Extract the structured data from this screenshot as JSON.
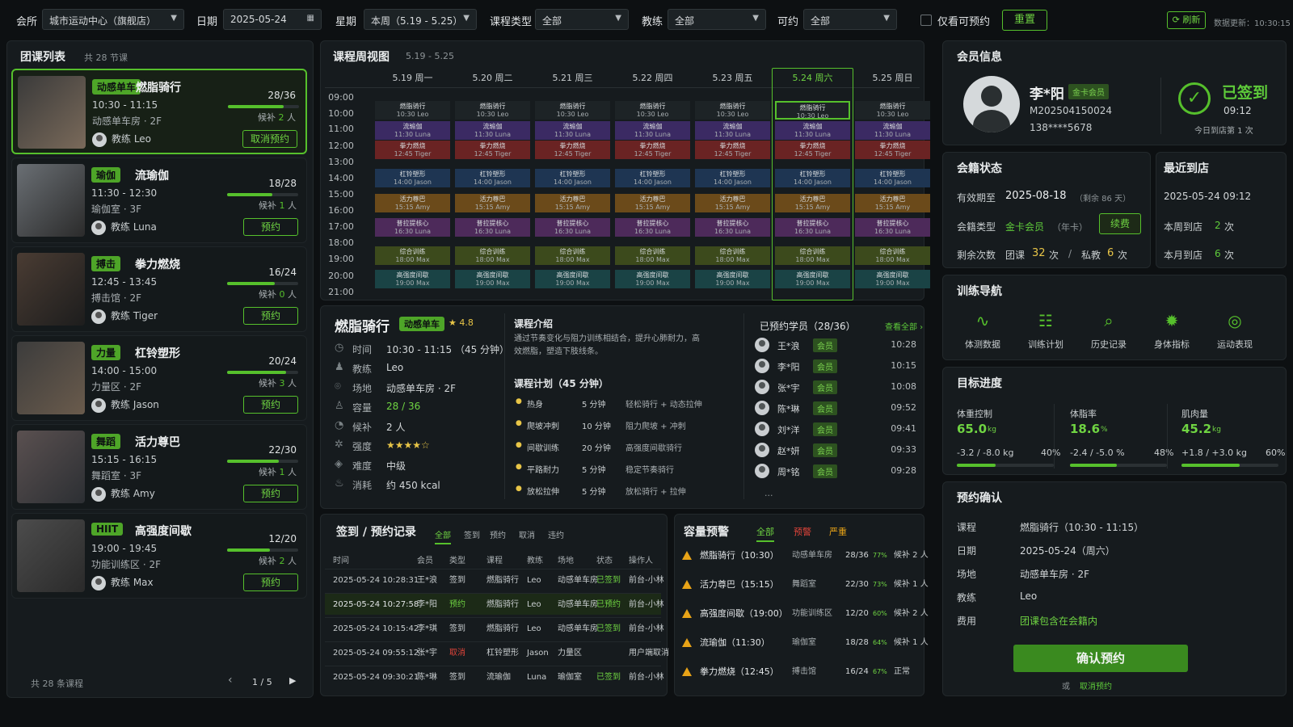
{
  "filters": {
    "club_label": "会所",
    "club_value": "城市运动中心（旗舰店）",
    "date_label": "日期",
    "date_value": "2025-05-24",
    "week_label": "星期",
    "week_value": "本周（5.19 - 5.25）",
    "type_label": "课程类型",
    "type_value": "全部",
    "coach_label": "教练",
    "coach_value": "全部",
    "avail_label": "可约",
    "avail_value": "全部",
    "only_bookable": "仅看可预约",
    "reset": "重置",
    "refresh": "刷新",
    "updated": "数据更新：10:30:15"
  },
  "class_list": {
    "title": "团课列表",
    "count": "共 28 节课",
    "items": [
      {
        "tag": "动感单车",
        "name": "燃脂骑行",
        "time": "10:30 - 11:15",
        "room": "动感单车房 · 2F",
        "coach": "教练  Leo",
        "count": "28/36",
        "fill": 0.78,
        "wait_label": "候补",
        "wait_num": "2",
        "wait_unit": "人",
        "action": "取消预约"
      },
      {
        "tag": "瑜伽",
        "name": "流瑜伽",
        "time": "11:30 - 12:30",
        "room": "瑜伽室 · 3F",
        "coach": "教练  Luna",
        "count": "18/28",
        "fill": 0.64,
        "wait_label": "候补",
        "wait_num": "1",
        "wait_unit": "人",
        "action": "预约"
      },
      {
        "tag": "搏击",
        "name": "拳力燃烧",
        "time": "12:45 - 13:45",
        "room": "搏击馆 · 2F",
        "coach": "教练  Tiger",
        "count": "16/24",
        "fill": 0.67,
        "wait_label": "候补",
        "wait_num": "0",
        "wait_unit": "人",
        "action": "预约"
      },
      {
        "tag": "力量",
        "name": "杠铃塑形",
        "time": "14:00 - 15:00",
        "room": "力量区 · 2F",
        "coach": "教练  Jason",
        "count": "20/24",
        "fill": 0.83,
        "wait_label": "候补",
        "wait_num": "3",
        "wait_unit": "人",
        "action": "预约"
      },
      {
        "tag": "舞蹈",
        "name": "活力尊巴",
        "time": "15:15 - 16:15",
        "room": "舞蹈室 · 3F",
        "coach": "教练  Amy",
        "count": "22/30",
        "fill": 0.73,
        "wait_label": "候补",
        "wait_num": "1",
        "wait_unit": "人",
        "action": "预约"
      },
      {
        "tag": "HIIT",
        "name": "高强度间歇",
        "time": "19:00 - 19:45",
        "room": "功能训练区 · 2F",
        "coach": "教练  Max",
        "count": "12/20",
        "fill": 0.6,
        "wait_label": "候补",
        "wait_num": "2",
        "wait_unit": "人",
        "action": "预约"
      }
    ],
    "footer": "共 28 条课程",
    "page": "1 / 5"
  },
  "calendar": {
    "title": "课程周视图",
    "range": "5.19 - 5.25",
    "days": [
      "5.19 周一",
      "5.20 周二",
      "5.21 周三",
      "5.22 周四",
      "5.23 周五",
      "5.24 周六",
      "5.25 周日"
    ],
    "times": [
      "09:00",
      "10:00",
      "11:00",
      "12:00",
      "13:00",
      "14:00",
      "15:00",
      "16:00",
      "17:00",
      "18:00",
      "19:00",
      "20:00",
      "21:00"
    ],
    "classes": [
      {
        "name": "燃脂骑行",
        "sub": "10:30  Leo",
        "color": "#1d2326"
      },
      {
        "name": "流瑜伽",
        "sub": "11:30  Luna",
        "color": "#3b2a63"
      },
      {
        "name": "拳力燃烧",
        "sub": "12:45  Tiger",
        "color": "#6a2323"
      },
      {
        "name": "杠铃塑形",
        "sub": "14:00  Jason",
        "color": "#1e3552"
      },
      {
        "name": "活力尊巴",
        "sub": "15:15  Amy",
        "color": "#6b4a1a"
      },
      {
        "name": "普拉提核心",
        "sub": "16:30  Luna",
        "color": "#4d2a5a"
      },
      {
        "name": "综合训练",
        "sub": "18:00  Max",
        "color": "#3c4a1c"
      },
      {
        "name": "高强度间歇",
        "sub": "19:00  Max",
        "color": "#1a4345"
      }
    ]
  },
  "detail": {
    "name": "燃脂骑行",
    "tag": "动感单车",
    "rating": "★ 4.8",
    "rows": [
      {
        "label": "时间",
        "value": "10:30 - 11:15  （45 分钟）",
        "icon": "clock-icon",
        "glyph": "◷"
      },
      {
        "label": "教练",
        "value": "Leo",
        "icon": "coach-icon",
        "glyph": "♟"
      },
      {
        "label": "场地",
        "value": "动感单车房 · 2F",
        "icon": "location-icon",
        "glyph": "⌾"
      },
      {
        "label": "容量",
        "value": "28 / 36",
        "icon": "people-icon",
        "glyph": "♙"
      },
      {
        "label": "候补",
        "value": "2 人",
        "icon": "waitlist-icon",
        "glyph": "◔"
      },
      {
        "label": "强度",
        "value": "★★★★☆",
        "icon": "intensity-icon",
        "glyph": "✲"
      },
      {
        "label": "难度",
        "value": "中级",
        "icon": "difficulty-icon",
        "glyph": "◈"
      },
      {
        "label": "消耗",
        "value": "约 450 kcal",
        "icon": "calorie-icon",
        "glyph": "♨"
      }
    ],
    "intro_title": "课程介绍",
    "intro": "通过节奏变化与阻力训练相结合，提升心肺耐力，高效燃脂，塑造下肢线条。",
    "plan_title": "课程计划（45 分钟）",
    "plan": [
      {
        "phase": "热身",
        "dur": "5 分钟",
        "desc": "轻松骑行 + 动态拉伸"
      },
      {
        "phase": "爬坡冲刺",
        "dur": "10 分钟",
        "desc": "阻力爬坡 + 冲刺"
      },
      {
        "phase": "间歇训练",
        "dur": "20 分钟",
        "desc": "高强度间歇骑行"
      },
      {
        "phase": "平路耐力",
        "dur": "5 分钟",
        "desc": "稳定节奏骑行"
      },
      {
        "phase": "放松拉伸",
        "dur": "5 分钟",
        "desc": "放松骑行 + 拉伸"
      }
    ],
    "booked_title": "已预约学员（28/36）",
    "view_all": "查看全部 ›",
    "students": [
      {
        "name": "王*浪",
        "badge": "会员",
        "time": "10:28"
      },
      {
        "name": "李*阳",
        "badge": "会员",
        "time": "10:15"
      },
      {
        "name": "张*宇",
        "badge": "会员",
        "time": "10:08"
      },
      {
        "name": "陈*琳",
        "badge": "会员",
        "time": "09:52"
      },
      {
        "name": "刘*洋",
        "badge": "会员",
        "time": "09:41"
      },
      {
        "name": "赵*妍",
        "badge": "会员",
        "time": "09:33"
      },
      {
        "name": "周*铭",
        "badge": "会员",
        "time": "09:28"
      }
    ],
    "more": "..."
  },
  "records": {
    "title": "签到 / 预约记录",
    "tabs": [
      "全部",
      "签到",
      "预约",
      "取消",
      "违约"
    ],
    "headers": [
      "时间",
      "会员",
      "类型",
      "课程",
      "教练",
      "场地",
      "状态",
      "操作人"
    ],
    "rows": [
      [
        "2025-05-24 10:28:31",
        "王*浪",
        "签到",
        "燃脂骑行",
        "Leo",
        "动感单车房",
        "已签到",
        "前台-小林"
      ],
      [
        "2025-05-24 10:27:58",
        "李*阳",
        "预约",
        "燃脂骑行",
        "Leo",
        "动感单车房",
        "已预约",
        "前台-小林"
      ],
      [
        "2025-05-24 10:15:42",
        "李*琪",
        "签到",
        "燃脂骑行",
        "Leo",
        "动感单车房",
        "已签到",
        "前台-小林"
      ],
      [
        "2025-05-24 09:55:12",
        "张*宇",
        "取消",
        "杠铃塑形",
        "Jason",
        "力量区",
        "",
        "用户端取消"
      ],
      [
        "2025-05-24 09:30:21",
        "陈*琳",
        "签到",
        "流瑜伽",
        "Luna",
        "瑜伽室",
        "已签到",
        "前台-小林"
      ]
    ]
  },
  "capacity": {
    "title": "容量预警",
    "tabs": [
      "全部",
      "预警",
      "严重"
    ],
    "rows": [
      {
        "name": "燃脂骑行（10:30）",
        "room": "动感单车房",
        "cnt": "28/36",
        "pct": "77%",
        "note": "候补 2 人"
      },
      {
        "name": "活力尊巴（15:15）",
        "room": "舞蹈室",
        "cnt": "22/30",
        "pct": "73%",
        "note": "候补 1 人"
      },
      {
        "name": "高强度间歇（19:00）",
        "room": "功能训练区",
        "cnt": "12/20",
        "pct": "60%",
        "note": "候补 2 人"
      },
      {
        "name": "流瑜伽（11:30）",
        "room": "瑜伽室",
        "cnt": "18/28",
        "pct": "64%",
        "note": "候补 1 人"
      },
      {
        "name": "拳力燃烧（12:45）",
        "room": "搏击馆",
        "cnt": "16/24",
        "pct": "67%",
        "note": "正常"
      }
    ]
  },
  "member": {
    "title": "会员信息",
    "name": "李*阳",
    "level": "金卡会员",
    "id": "M202504150024",
    "phone": "138****5678",
    "checked": "已签到",
    "checked_time": "09:12",
    "checked_note": "今日到店第 1 次",
    "status_title": "会籍状态",
    "valid_label": "有效期至",
    "valid_value": "2025-08-18",
    "valid_note": "（剩余 86 天）",
    "type_label": "会籍类型",
    "type_value": "金卡会员",
    "type_note": "（年卡）",
    "renew": "续费",
    "remain_label": "剩余次数",
    "group_label": "团课",
    "group_num": "32",
    "group_unit": "次",
    "slash": "/",
    "pt_label": "私教",
    "pt_num": "6",
    "pt_unit": "次",
    "recent_title": "最近到店",
    "recent_time": "2025-05-24 09:12",
    "week_label": "本周到店",
    "week_num": "2",
    "week_unit": "次",
    "month_label": "本月到店",
    "month_num": "6",
    "month_unit": "次"
  },
  "nav": {
    "title": "训练导航",
    "items": [
      {
        "label": "体测数据",
        "icon": "heartbeat-icon",
        "glyph": "∿"
      },
      {
        "label": "训练计划",
        "icon": "clipboard-icon",
        "glyph": "☷"
      },
      {
        "label": "历史记录",
        "icon": "history-search-icon",
        "glyph": "⌕"
      },
      {
        "label": "身体指标",
        "icon": "body-metrics-icon",
        "glyph": "✹"
      },
      {
        "label": "运动表现",
        "icon": "performance-icon",
        "glyph": "◎"
      }
    ]
  },
  "goals": {
    "title": "目标进度",
    "items": [
      {
        "label": "体重控制",
        "value": "65.0",
        "unit": "kg",
        "delta": "-3.2 / -8.0 kg",
        "pct": "40%",
        "fill": 0.4
      },
      {
        "label": "体脂率",
        "value": "18.6",
        "unit": "%",
        "delta": "-2.4 / -5.0 %",
        "pct": "48%",
        "fill": 0.48
      },
      {
        "label": "肌肉量",
        "value": "45.2",
        "unit": "kg",
        "delta": "+1.8 / +3.0 kg",
        "pct": "60%",
        "fill": 0.6
      }
    ]
  },
  "confirm": {
    "title": "预约确认",
    "rows": [
      {
        "label": "课程",
        "value": "燃脂骑行（10:30 - 11:15）"
      },
      {
        "label": "日期",
        "value": "2025-05-24（周六）"
      },
      {
        "label": "场地",
        "value": "动感单车房 · 2F"
      },
      {
        "label": "教练",
        "value": "Leo"
      },
      {
        "label": "费用",
        "value": "团课包含在会籍内"
      }
    ],
    "button": "确认预约",
    "or": "或",
    "cancel": "取消预约"
  },
  "colors": {
    "accent": "#56c02c",
    "warning": "#e8a317",
    "danger": "#e0443a",
    "background": "#0d1012"
  }
}
